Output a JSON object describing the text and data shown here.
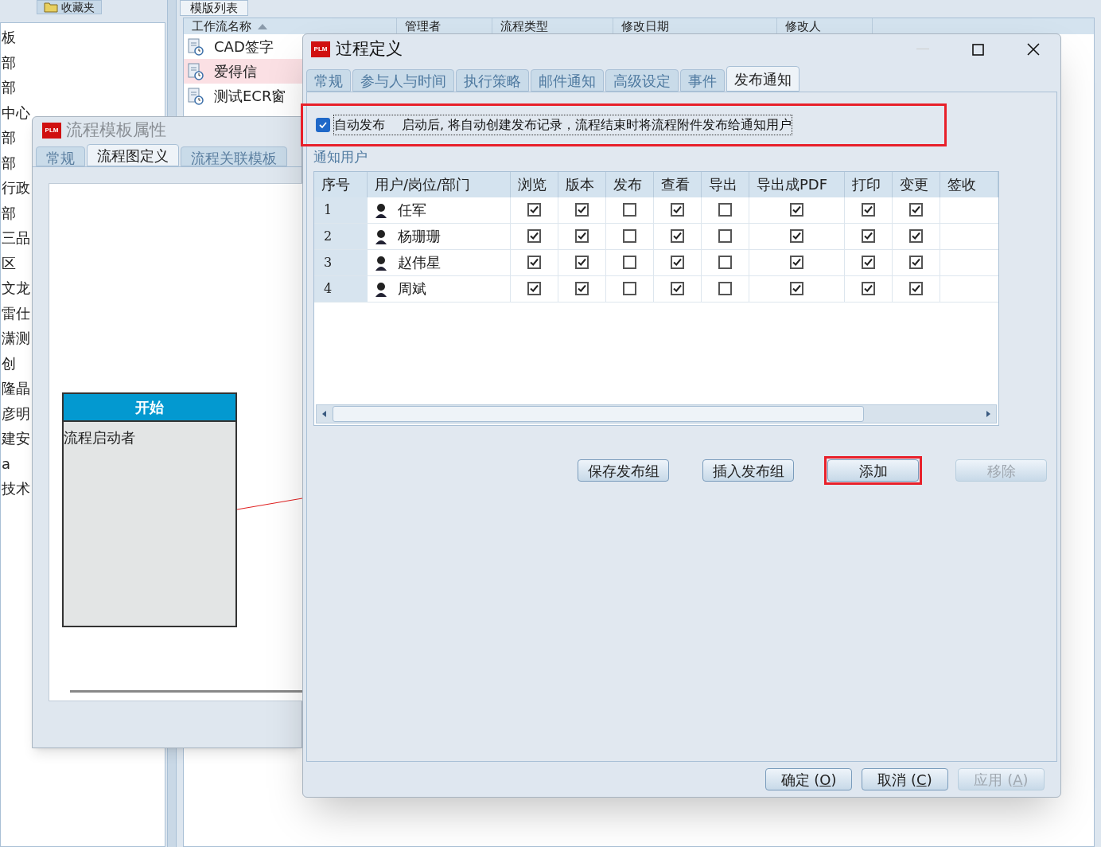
{
  "background_app": {
    "left_tabs": [
      {
        "label": "收藏夹",
        "selected": false
      }
    ],
    "tree_items": [
      {
        "label": "板"
      },
      {
        "label": "部"
      },
      {
        "label": "部"
      },
      {
        "label": "中心"
      },
      {
        "label": "部"
      },
      {
        "label": "部"
      },
      {
        "label": "行政"
      },
      {
        "label": "部"
      },
      {
        "label": "三品"
      },
      {
        "label": "区"
      },
      {
        "label": "文龙"
      },
      {
        "label": "雷仕"
      },
      {
        "label": "潇测"
      },
      {
        "label": "创"
      },
      {
        "label": "隆晶"
      },
      {
        "label": "彦明"
      },
      {
        "label": "建安"
      },
      {
        "label": "a"
      },
      {
        "label": "技术"
      }
    ],
    "list_tab": "模版列表",
    "list_columns": [
      "工作流名称",
      "管理者",
      "流程类型",
      "修改日期",
      "修改人"
    ],
    "list_rows": [
      {
        "name": "CAD签字",
        "selected": false
      },
      {
        "name": "爱得信",
        "selected": true
      },
      {
        "name": "测试ECR窗",
        "selected": false
      }
    ]
  },
  "template_window": {
    "logo": "PLM",
    "title": "流程模板属性",
    "tabs": [
      {
        "label": "常规",
        "selected": false
      },
      {
        "label": "流程图定义",
        "selected": true
      },
      {
        "label": "流程关联模板",
        "selected": false
      }
    ],
    "node": {
      "header": "开始",
      "body": "流程启动者"
    }
  },
  "dialog": {
    "logo": "PLM",
    "title": "过程定义",
    "tabs": [
      {
        "label": "常规",
        "selected": false
      },
      {
        "label": "参与人与时间",
        "selected": false
      },
      {
        "label": "执行策略",
        "selected": false
      },
      {
        "label": "邮件通知",
        "selected": false
      },
      {
        "label": "高级设定",
        "selected": false
      },
      {
        "label": "事件",
        "selected": false
      },
      {
        "label": "发布通知",
        "selected": true
      }
    ],
    "auto_publish": {
      "checked": true,
      "highlighted": true,
      "label": "自动发布　 启动后, 将自动创建发布记录，流程结束时将流程附件发布给通知用户"
    },
    "section_label": "通知用户",
    "table": {
      "columns": [
        {
          "label": "序号",
          "kind": "index"
        },
        {
          "label": "用户/岗位/部门",
          "kind": "user"
        },
        {
          "label": "浏览",
          "kind": "check"
        },
        {
          "label": "版本",
          "kind": "check"
        },
        {
          "label": "发布",
          "kind": "check"
        },
        {
          "label": "查看",
          "kind": "check"
        },
        {
          "label": "导出",
          "kind": "check"
        },
        {
          "label": "导出成PDF",
          "kind": "check"
        },
        {
          "label": "打印",
          "kind": "check"
        },
        {
          "label": "变更",
          "kind": "check"
        },
        {
          "label": "签收",
          "kind": "empty"
        }
      ],
      "rows": [
        {
          "index": "1",
          "user": "任军",
          "checks": [
            true,
            true,
            false,
            true,
            false,
            true,
            true,
            true
          ]
        },
        {
          "index": "2",
          "user": "杨珊珊",
          "checks": [
            true,
            true,
            false,
            true,
            false,
            true,
            true,
            true
          ]
        },
        {
          "index": "3",
          "user": "赵伟星",
          "checks": [
            true,
            true,
            false,
            true,
            false,
            true,
            true,
            true
          ]
        },
        {
          "index": "4",
          "user": "周斌",
          "checks": [
            true,
            true,
            false,
            true,
            false,
            true,
            true,
            true
          ]
        }
      ]
    },
    "actions": [
      {
        "label": "保存发布组",
        "disabled": false,
        "highlighted": false
      },
      {
        "label": "插入发布组",
        "disabled": false,
        "highlighted": false
      },
      {
        "label": "添加",
        "disabled": false,
        "highlighted": true
      },
      {
        "label": "移除",
        "disabled": true,
        "highlighted": false
      }
    ],
    "footer_buttons": [
      {
        "label": "确定 (",
        "mnemonic": "O",
        "suffix": ")",
        "disabled": false
      },
      {
        "label": "取消 (",
        "mnemonic": "C",
        "suffix": ")",
        "disabled": false
      },
      {
        "label": "应用 (",
        "mnemonic": "A",
        "suffix": ")",
        "disabled": true
      }
    ]
  }
}
